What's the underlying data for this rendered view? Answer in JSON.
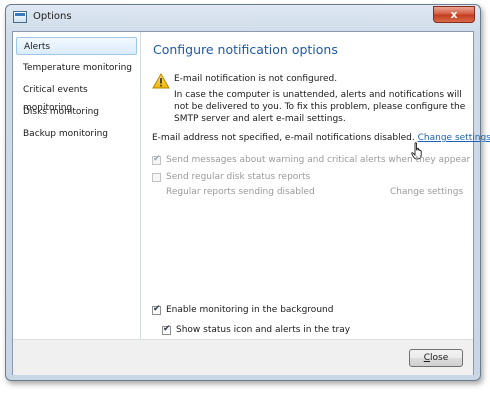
{
  "window": {
    "title": "Options",
    "close_glyph": "x"
  },
  "sidebar": {
    "items": [
      {
        "label": "Alerts",
        "selected": true
      },
      {
        "label": "Temperature monitoring"
      },
      {
        "label": "Critical events monitoring"
      },
      {
        "label": "Disks monitoring"
      },
      {
        "label": "Backup monitoring"
      }
    ]
  },
  "main": {
    "heading": "Configure notification options",
    "warning": {
      "icon": "warning-icon",
      "title": "E-mail notification is not configured.",
      "text": "In case the computer is unattended, alerts and notifications will not be delivered to you. To fix this problem, please configure the SMTP server and alert e-mail settings."
    },
    "email_status": "E-mail address not specified, e-mail notifications disabled.",
    "change_settings_link": "Change settings",
    "send_alerts": {
      "label": "Send messages about warning and critical alerts when they appear",
      "checked": true,
      "enabled": false
    },
    "disk_reports": {
      "label": "Send regular disk status reports",
      "checked": false,
      "enabled": false
    },
    "reports_status": "Regular reports sending disabled",
    "reports_change_settings": "Change settings",
    "monitor_background": {
      "label": "Enable monitoring in the background",
      "checked": true
    },
    "status_icon_tray": {
      "label": "Show status icon and alerts in the tray",
      "checked": true
    }
  },
  "footer": {
    "close_label": "Close",
    "close_mnemonic": "C",
    "close_rest": "lose"
  },
  "colors": {
    "heading": "#1e5aa8",
    "link": "#1c63b7",
    "selection": "#dcecfc"
  }
}
